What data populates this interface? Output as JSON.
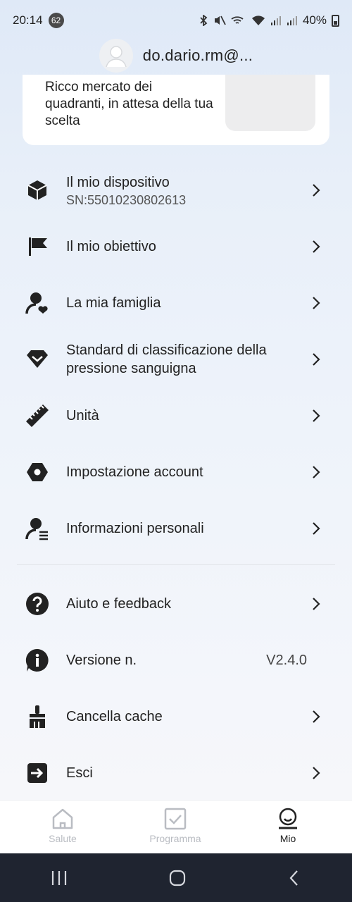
{
  "status_bar": {
    "time": "20:14",
    "notification_count": "62",
    "battery": "40%"
  },
  "profile": {
    "email": "do.dario.rm@..."
  },
  "watch_card": {
    "text": "Ricco mercato dei quadranti, in attesa della tua scelta"
  },
  "menu": {
    "device": {
      "label": "Il mio dispositivo",
      "serial": "SN:55010230802613",
      "icon": "cube-icon"
    },
    "goal": {
      "label": "Il mio obiettivo",
      "icon": "flag-icon"
    },
    "family": {
      "label": "La mia famiglia",
      "icon": "family-heart-icon"
    },
    "bp_standard": {
      "label": "Standard di classificazione della pressione sanguigna",
      "icon": "diamond-icon"
    },
    "units": {
      "label": "Unità",
      "icon": "ruler-icon"
    },
    "account": {
      "label": "Impostazione account",
      "icon": "hexagon-settings-icon"
    },
    "personal": {
      "label": "Informazioni personali",
      "icon": "person-info-icon"
    },
    "help": {
      "label": "Aiuto e feedback",
      "icon": "question-icon"
    },
    "version": {
      "label": "Versione n.",
      "value": "V2.4.0",
      "icon": "info-icon"
    },
    "cache": {
      "label": "Cancella cache",
      "icon": "broom-icon"
    },
    "logout": {
      "label": "Esci",
      "icon": "exit-icon"
    }
  },
  "bottom_nav": {
    "tabs": [
      {
        "label": "Salute",
        "icon": "home-icon",
        "active": false
      },
      {
        "label": "Programma",
        "icon": "checkbox-icon",
        "active": false
      },
      {
        "label": "Mio",
        "icon": "profile-face-icon",
        "active": true
      }
    ]
  },
  "colors": {
    "text": "#222222",
    "inactive_nav": "#b9bcc2",
    "system_nav_bg": "#1f2430"
  }
}
